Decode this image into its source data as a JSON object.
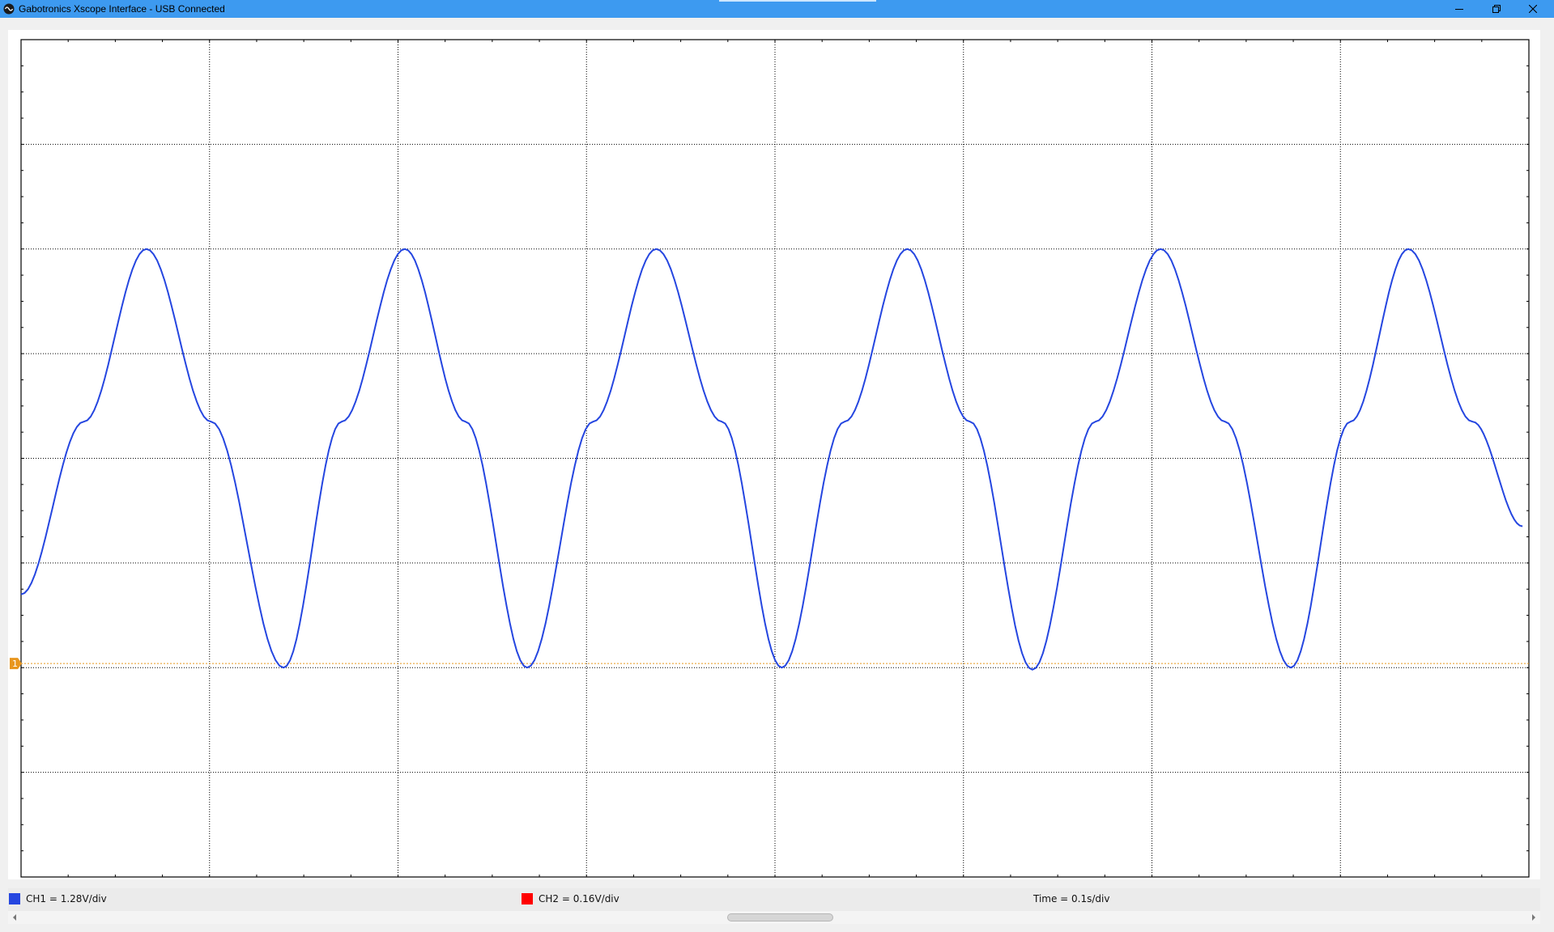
{
  "window": {
    "title": "Gabotronics Xscope Interface - USB Connected",
    "app_icon": "scope-icon",
    "controls": [
      "minimize-icon",
      "restore-icon",
      "close-icon"
    ]
  },
  "colors": {
    "titlebar": "#3d9af0",
    "ch1": "#2546e0",
    "ch2": "#ff0000",
    "trigger": "#e8961e",
    "grid": "#000000"
  },
  "status": {
    "ch1_label": "CH1 = 1.28V/div",
    "ch2_label": "CH2 = 0.16V/div",
    "time_label": "Time = 0.1s/div"
  },
  "trigger_marker": {
    "label": "1"
  },
  "chart_data": {
    "type": "line",
    "grid": {
      "x_divisions": 8,
      "y_divisions": 8,
      "style": "dotted"
    },
    "ch1_volts_per_div": 1.28,
    "time_per_div_s": 0.1,
    "x_range_div": [
      0,
      8
    ],
    "y_range_div": [
      0,
      8
    ],
    "series": [
      {
        "name": "CH1",
        "color": "#2546e0",
        "x_div": [
          0,
          0.333,
          0.665,
          1.008,
          1.393,
          1.701,
          2.036,
          2.358,
          2.685,
          3.035,
          3.37,
          3.718,
          4.036,
          4.369,
          4.702,
          5.035,
          5.366,
          5.7,
          6.046,
          6.388,
          6.737,
          7.053,
          7.36,
          7.701,
          7.966
        ],
        "y_div": [
          2.7,
          4.35,
          6.0,
          4.35,
          2.0,
          4.35,
          6.0,
          4.35,
          2.0,
          4.35,
          6.0,
          4.35,
          2.0,
          4.35,
          6.0,
          4.35,
          1.98,
          4.35,
          6.0,
          4.35,
          2.0,
          4.35,
          6.0,
          4.35,
          3.35
        ]
      }
    ],
    "trigger_level_div": 2.04,
    "annotations": [
      "CH1 = 1.28V/div",
      "CH2 = 0.16V/div",
      "Time = 0.1s/div"
    ]
  }
}
